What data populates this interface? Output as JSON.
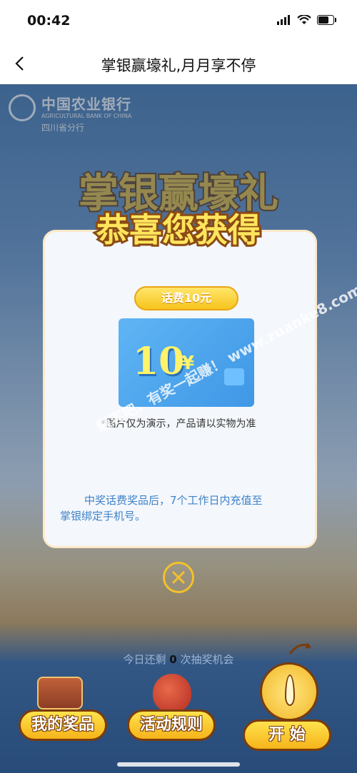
{
  "status_bar": {
    "time": "00:42"
  },
  "nav": {
    "title": "掌银赢壕礼,月月享不停"
  },
  "bank": {
    "name_cn": "中国农业银行",
    "name_en": "AGRICULTURAL BANK OF CHINA",
    "branch": "四川省分行"
  },
  "hero": {
    "title": "掌银赢壕礼"
  },
  "modal": {
    "title": "恭喜您获得",
    "prize_badge": "话费10元",
    "card_amount": "10",
    "card_currency": "¥",
    "note": "*图片仅为演示，产品请以实物为准",
    "info_line1": "中奖话费奖品后，7个工作日内充值至",
    "info_line2": "掌银绑定手机号。"
  },
  "watermark": "赚客吧，有奖一起赚！ www.zuanke8.com",
  "bottom": {
    "chance_prefix": "今日还剩",
    "chance_count": "0",
    "chance_suffix": "次抽奖机会",
    "my_prizes": "我的奖品",
    "rules": "活动规则",
    "start": "开 始"
  },
  "colors": {
    "accent_yellow": "#f6b41b",
    "info_blue": "#3f83c8",
    "card_blue": "#4aa3ec"
  }
}
